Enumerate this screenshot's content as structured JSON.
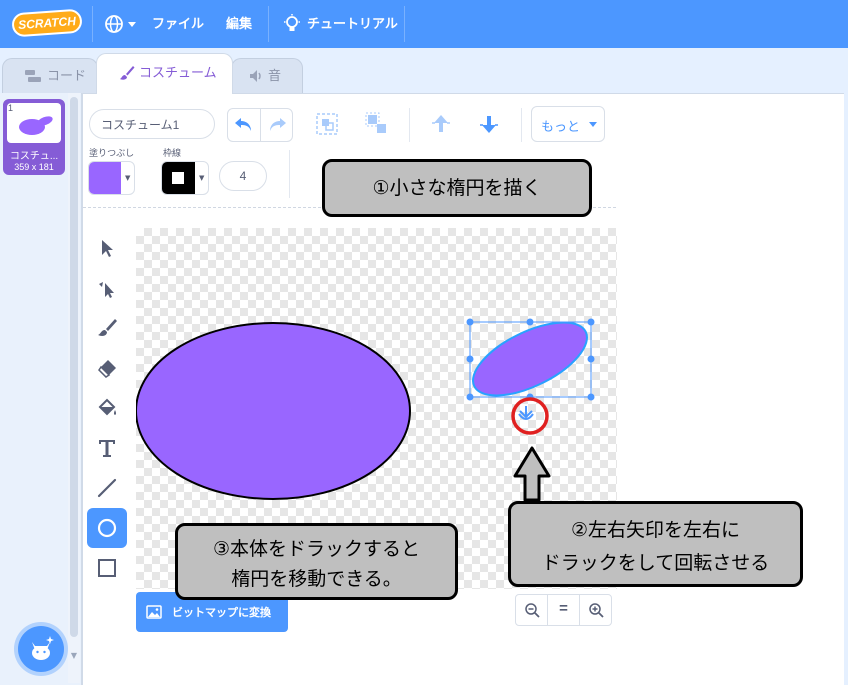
{
  "menubar": {
    "logo_text": "SCRATCH",
    "globe_icon": "globe-icon",
    "file_label": "ファイル",
    "edit_label": "編集",
    "tutorial_label": "チュートリアル",
    "bg_color": "#4c97ff"
  },
  "tabs": [
    {
      "label": "コード",
      "icon": "code-blocks-icon",
      "active": false
    },
    {
      "label": "コスチューム",
      "icon": "paintbrush-icon",
      "active": true
    },
    {
      "label": "音",
      "icon": "speaker-icon",
      "active": false
    }
  ],
  "costumes": [
    {
      "number": "1",
      "name": "コスチュ...",
      "size": "359 x 181",
      "selected": true
    }
  ],
  "editor": {
    "costume_name": "コスチューム1",
    "fill_label": "塗りつぶし",
    "fill_color": "#9966ff",
    "outline_label": "枠線",
    "outline_color": "#000000",
    "outline_width": "4",
    "more_label": "もっと",
    "bitmap_button": "ビットマップに変換",
    "zoom_reset": "="
  },
  "tools": [
    {
      "name": "select-tool",
      "active": false
    },
    {
      "name": "reshape-tool",
      "active": false
    },
    {
      "name": "brush-tool",
      "active": false
    },
    {
      "name": "eraser-tool",
      "active": false
    },
    {
      "name": "fill-tool",
      "active": false
    },
    {
      "name": "text-tool",
      "active": false
    },
    {
      "name": "line-tool",
      "active": false
    },
    {
      "name": "circle-tool",
      "active": true
    },
    {
      "name": "rectangle-tool",
      "active": false
    }
  ],
  "annotations": {
    "callout1": "①小さな楕円を描く",
    "callout2_line1": "②左右矢印を左右に",
    "callout2_line2": "ドラックをして回転させる",
    "callout3_line1": "③本体をドラックすると",
    "callout3_line2": "楕円を移動できる。"
  },
  "colors": {
    "accent": "#4c97ff",
    "costume_accent": "#855cd6",
    "shape_fill": "#9966ff",
    "highlight_circle": "#e02020",
    "callout_bg": "#bfbfbf"
  }
}
